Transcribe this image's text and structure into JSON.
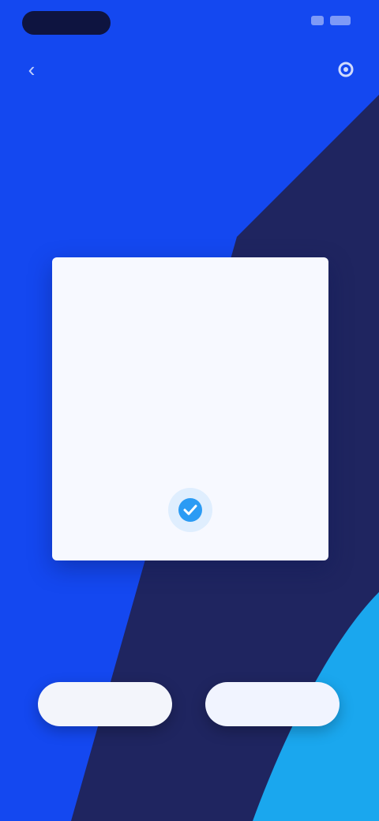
{
  "status_bar": {
    "time": "",
    "icons": [
      "signal-icon",
      "battery-icon"
    ]
  },
  "header": {
    "title": "",
    "back_icon": "arrow-left-icon",
    "settings_icon": "gear-icon"
  },
  "card": {
    "top_label": "",
    "value": "",
    "action_icon": "check-circle-icon"
  },
  "caption": "",
  "actions": {
    "left_label": "",
    "right_label": ""
  },
  "colors": {
    "background_blue": "#1448f0",
    "background_navy": "#1f2560",
    "accent_cyan": "#1aa7ee",
    "card_bg": "#f7f9ff",
    "action_blue": "#2b9bf4"
  }
}
